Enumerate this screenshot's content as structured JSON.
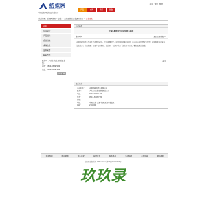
{
  "header": {
    "logo_title": "纺织网",
    "logo_url": "www.tnc.com.cn",
    "logo_slogan": "中国纺织网 纺织品行业门户",
    "top_links": [
      "首页",
      "注册",
      "帮助"
    ],
    "nav": [
      {
        "label": "产品",
        "active": true
      },
      {
        "label": "求购",
        "active": false
      },
      {
        "label": "资讯",
        "active": false
      },
      {
        "label": "展会",
        "active": false
      }
    ]
  },
  "breadcrumb": {
    "text": "当前位置：纺织网首页 > 企业 > 无锡某棉纺企业通讯信息 >",
    "strong": "企业动态"
  },
  "sidebar": {
    "items": [
      {
        "label": "首页",
        "active": true
      },
      {
        "label": "公司简介",
        "active": false
      },
      {
        "label": "产品展示",
        "active": false
      },
      {
        "label": "企业动态",
        "active": false
      },
      {
        "label": "求购信息",
        "active": false
      },
      {
        "label": "证书荣誉",
        "active": false
      },
      {
        "label": "联系方式",
        "active": false
      }
    ],
    "contact_lines": [
      "联系人：卢先生(先生)销售部(业",
      "务)",
      "电话：0510-83997180",
      "传真：0510-83997180"
    ],
    "contact_button": "在线留言"
  },
  "main": {
    "section_title": "公司动态",
    "article_title": "无锡某棉纺企业通讯信息与新闻",
    "article_meta": "发布时间",
    "article_back": "返回公司动态>>",
    "article_body": "无锡某棉纺企业专业生产各类纺织品，产品质量稳定，深受国内外客户好评。本公司以诚信经营为宗旨，欢迎新老客户来电洽谈业务，共谋发展。主要产品有棉纱、混纺纱、色纺纱等，广泛应用于针织、梭织及家纺领域。",
    "back_link": "返回"
  },
  "contact": {
    "title": "联系方式",
    "rows": [
      {
        "label": "公司名称：",
        "value": "无锡某棉纺企业有限公司"
      },
      {
        "label": "联系人：",
        "value": "卢先生(先生)销售部(业务)"
      },
      {
        "label": "电话：",
        "value": "0510-83997180"
      },
      {
        "label": "传真：",
        "value": "0510-83997180"
      },
      {
        "label": "邮箱：",
        "value": ""
      },
      {
        "label": "地址：",
        "value": "中国 江苏 无锡 中国 无锡市惠山区"
      },
      {
        "label": "邮编：",
        "value": "214000"
      }
    ]
  },
  "footer": {
    "links": [
      "关于我们",
      "网站地图",
      "联系方式",
      "诚聘英才",
      "服务条款",
      "法律声明",
      "友情链接",
      "网站帮助"
    ],
    "copyright": "纺织网 版权所有 1997-2015 浙ICP备11000000号"
  },
  "watermark": "玖玖录",
  "colors": {
    "brand_red": "#cc1e1e",
    "active_orange": "#f08a00",
    "watermark_green": "#3e8c2d"
  }
}
